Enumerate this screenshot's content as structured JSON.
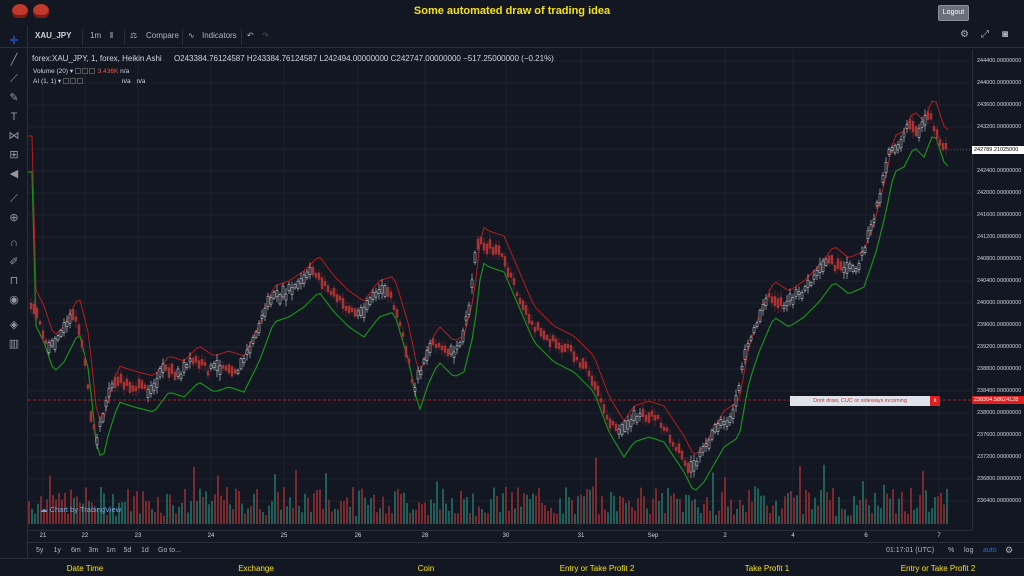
{
  "header": {
    "title": "Some automated draw of trading idea",
    "logout_label": "Logout"
  },
  "toolbar": {
    "symbol": "XAU_JPY",
    "interval": "1m",
    "compare_label": "Compare",
    "indicators_label": "Indicators"
  },
  "legend": {
    "series": "forex:XAU_JPY, 1, forex, Heikin Ashi",
    "ohlc": "O243384.76124587  H243384.76124587  L242494.00000000  C242747.00000000  −517.25000000 (−0.21%)",
    "volume_label": "Volume (20)",
    "volume_value": "3.436K",
    "volume_na": "n/a",
    "ai_label": "AI (1, 1)",
    "ai_value": "",
    "ai_na1": "n/a",
    "ai_na2": "n/a"
  },
  "price_axis": {
    "ticks": [
      "244400.00000000",
      "244000.00000000",
      "243600.00000000",
      "243200.00000000",
      "242800.00000000",
      "242400.00000000",
      "242000.00000000",
      "241600.00000000",
      "241200.00000000",
      "240800.00000000",
      "240400.00000000",
      "240000.00000000",
      "239600.00000000",
      "239200.00000000",
      "238800.00000000",
      "238400.00000000",
      "238000.00000000",
      "237600.00000000",
      "237200.00000000",
      "236800.00000000",
      "236400.00000000"
    ],
    "current_price": "242789.21025000",
    "red_price": "238304.58624128"
  },
  "time_axis": {
    "ticks": [
      "21",
      "22",
      "23",
      "24",
      "25",
      "26",
      "28",
      "30",
      "31",
      "Sep",
      "2",
      "4",
      "6",
      "7"
    ]
  },
  "annotation": {
    "text": "Dont draw, CUC or sideways incoming",
    "close": "x"
  },
  "watermark": "Chart by TradingView",
  "bottombar": {
    "ranges": [
      "5y",
      "1y",
      "6m",
      "3m",
      "1m",
      "5d",
      "1d"
    ],
    "goto": "Go to...",
    "clock": "01:17:01 (UTC)",
    "pct": "%",
    "log": "log",
    "auto": "auto"
  },
  "footer": {
    "columns": [
      "Date Time",
      "Exchange",
      "Coin",
      "Entry or Take Profit 2",
      "Take Profit 1",
      "Entry or Take Profit 2"
    ]
  },
  "colors": {
    "up": "#26a69a",
    "down": "#ef5350",
    "green_line": "#1b8f1b",
    "red_line": "#b71c1c",
    "accent_yellow": "#f5e11b"
  }
}
